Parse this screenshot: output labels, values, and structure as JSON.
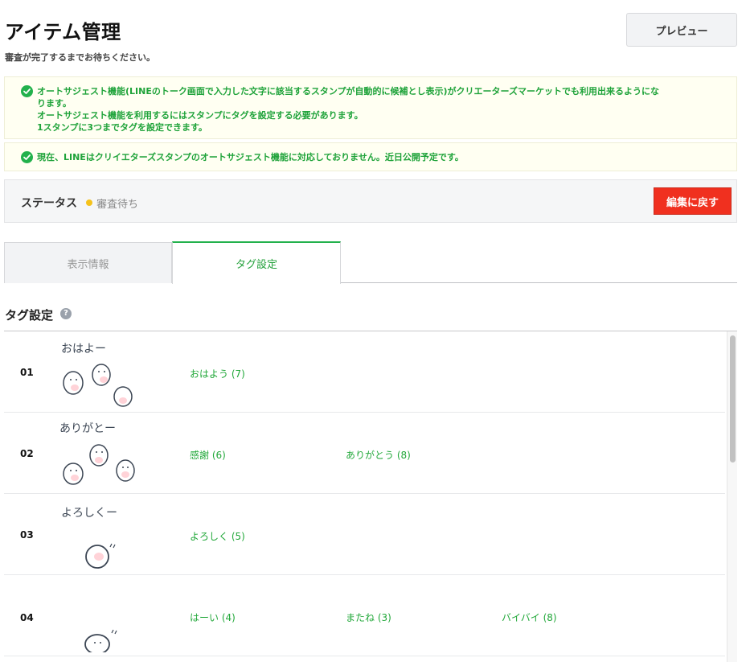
{
  "header": {
    "title": "アイテム管理",
    "subtitle": "審査が完了するまでお待ちください。",
    "preview_label": "プレビュー"
  },
  "notices": [
    {
      "icon": "check-circle-icon",
      "lines": [
        "オートサジェスト機能(LINEのトーク画面で入力した文字に該当するスタンプが自動的に候補とし表示)がクリエーターズマーケットでも利用出来るようにな",
        "ります。",
        "オートサジェスト機能を利用するにはスタンプにタグを設定する必要があります。",
        "1スタンプに3つまでタグを設定できます。"
      ]
    },
    {
      "icon": "check-circle-icon",
      "lines": [
        "現在、LINEはクリイエターズスタンプのオートサジェスト機能に対応しておりません。近日公開予定です。"
      ]
    }
  ],
  "status": {
    "label": "ステータス",
    "value": "審査待ち",
    "dot_color": "#f5c21b",
    "back_label": "編集に戻す"
  },
  "tabs": [
    {
      "label": "表示情報",
      "active": false
    },
    {
      "label": "タグ設定",
      "active": true
    }
  ],
  "section": {
    "title": "タグ設定",
    "help_icon": "question-circle-icon",
    "help_glyph": "?"
  },
  "rows": [
    {
      "num": "01",
      "caption": "おはよー",
      "tags": [
        "おはよう (7)"
      ]
    },
    {
      "num": "02",
      "caption": "ありがとー",
      "tags": [
        "感謝 (6)",
        "ありがとう (8)"
      ]
    },
    {
      "num": "03",
      "caption": "よろしくー",
      "tags": [
        "よろしく (5)"
      ]
    },
    {
      "num": "04",
      "caption": "",
      "tags": [
        "はーい (4)",
        "またね (3)",
        "バイバイ (8)"
      ]
    }
  ],
  "colors": {
    "accent_green": "#22b14c",
    "danger_red": "#f0301f",
    "notice_bg": "#fffff2"
  }
}
